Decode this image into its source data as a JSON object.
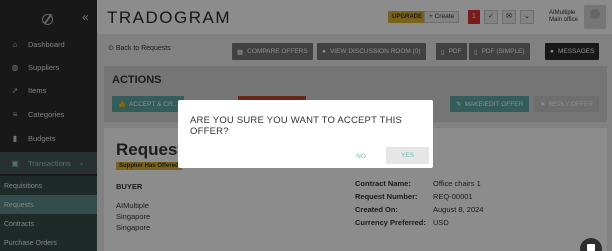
{
  "sidebar": {
    "items": [
      {
        "label": "Dashboard",
        "icon": "home-icon",
        "glyph": "⌂"
      },
      {
        "label": "Suppliers",
        "icon": "globe-icon",
        "glyph": "◍"
      },
      {
        "label": "Items",
        "icon": "rocket-icon",
        "glyph": "➚"
      },
      {
        "label": "Categories",
        "icon": "layers-icon",
        "glyph": "≡"
      },
      {
        "label": "Budgets",
        "icon": "chart-icon",
        "glyph": "▮"
      },
      {
        "label": "Transactions",
        "icon": "cart-icon",
        "glyph": "▣"
      }
    ],
    "sub_items": [
      {
        "label": "Requisitions"
      },
      {
        "label": "Requests"
      },
      {
        "label": "Contracts"
      },
      {
        "label": "Purchase Orders"
      }
    ]
  },
  "topbar": {
    "brand": "TRADOGRAM",
    "upgrade": "UPGRADE",
    "create": "+ Create",
    "notif_count": "1",
    "user_line1": "AIMultiple",
    "user_line2": "Main office"
  },
  "toolbar": {
    "back": "Back to Requests",
    "compare": "COMPARE OFFERS",
    "discussion": "VIEW DISCUSSION ROOM (0)",
    "pdf": "PDF",
    "pdf_simple": "PDF (SIMPLE)",
    "messages": "MESSAGES"
  },
  "actions": {
    "title": "ACTIONS",
    "accept": "ACCEPT & CR...",
    "edit": "MAKE/EDIT OFFER",
    "reply": "REPLY OFFER"
  },
  "request": {
    "title": "Request",
    "status": "Supplier Has Offered",
    "buyer_label": "BUYER",
    "buyer_company": "AIMultiple",
    "buyer_loc1": "Singapore",
    "buyer_loc2": "Singapore",
    "fields": [
      {
        "k": "Contract Name:",
        "v": "Office chairs 1"
      },
      {
        "k": "Request Number:",
        "v": "REQ-00001"
      },
      {
        "k": "Created On:",
        "v": "August 8, 2024"
      },
      {
        "k": "Currency Preferred:",
        "v": "USD"
      }
    ]
  },
  "modal": {
    "question": "ARE YOU SURE YOU WANT TO ACCEPT THIS OFFER?",
    "no": "NO",
    "yes": "YES"
  }
}
